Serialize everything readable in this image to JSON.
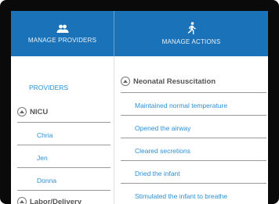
{
  "header": {
    "providers_tab": {
      "label": "MANAGE PROVIDERS",
      "icon": "people-icon"
    },
    "actions_tab": {
      "label": "MANAGE ACTIONS",
      "icon": "running-person-icon"
    },
    "bg_color": "#1a73b8"
  },
  "providers": {
    "title": "PROVIDERS",
    "groups": [
      {
        "name": "NICU",
        "items": [
          "Chria",
          "Jen",
          "Donna"
        ]
      },
      {
        "name": "Labor/Delivery",
        "items": []
      }
    ]
  },
  "actions": {
    "group": "Neonatal Resuscitation",
    "items": [
      "Maintained normal temperature",
      "Opened the airway",
      "Cleared secretions",
      "Dried the infant",
      "Stimulated the infant to breathe"
    ]
  },
  "colors": {
    "link": "#2b8fd6",
    "text": "#555555"
  }
}
